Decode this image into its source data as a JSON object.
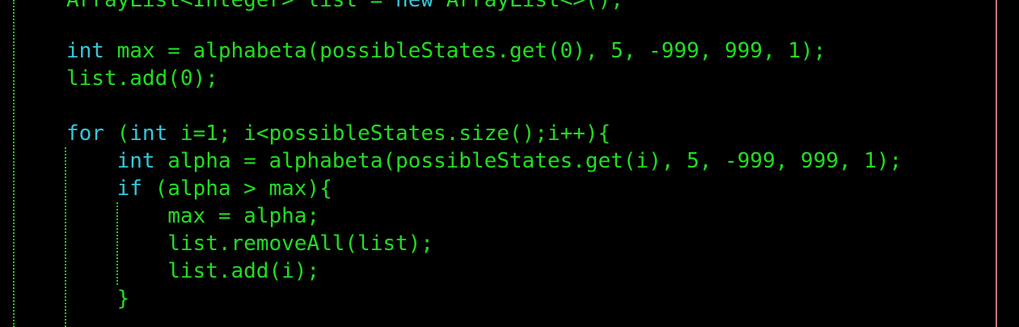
{
  "colors": {
    "background": "#000000",
    "code_text": "#22dd22",
    "keyword": "#33c8dc",
    "indent_guide": "#22c822",
    "margin_line": "#c87878"
  },
  "code": {
    "lines": [
      {
        "indent": "",
        "segments": [
          {
            "text": "ArrayList<Integer> list = ",
            "kw": false
          },
          {
            "text": "new",
            "kw": true
          },
          {
            "text": " ArrayList<>();",
            "kw": false
          }
        ]
      },
      {
        "indent": "",
        "segments": []
      },
      {
        "indent": "",
        "segments": [
          {
            "text": "int",
            "kw": true
          },
          {
            "text": " max = alphabeta(possibleStates.get(0), 5, -999, 999, 1);",
            "kw": false
          }
        ]
      },
      {
        "indent": "",
        "segments": [
          {
            "text": "list.add(0);",
            "kw": false
          }
        ]
      },
      {
        "indent": "",
        "segments": []
      },
      {
        "indent": "",
        "segments": [
          {
            "text": "for",
            "kw": true
          },
          {
            "text": " (",
            "kw": false
          },
          {
            "text": "int",
            "kw": true
          },
          {
            "text": " i=1; i<possibleStates.size();i++){",
            "kw": false
          }
        ]
      },
      {
        "indent": "    ",
        "segments": [
          {
            "text": "int",
            "kw": true
          },
          {
            "text": " alpha = alphabeta(possibleStates.get(i), 5, -999, 999, 1);",
            "kw": false
          }
        ]
      },
      {
        "indent": "    ",
        "segments": [
          {
            "text": "if",
            "kw": true
          },
          {
            "text": " (alpha > max){",
            "kw": false
          }
        ]
      },
      {
        "indent": "        ",
        "segments": [
          {
            "text": "max = alpha;",
            "kw": false
          }
        ]
      },
      {
        "indent": "        ",
        "segments": [
          {
            "text": "list.removeAll(list);",
            "kw": false
          }
        ]
      },
      {
        "indent": "        ",
        "segments": [
          {
            "text": "list.add(i);",
            "kw": false
          }
        ]
      },
      {
        "indent": "    ",
        "segments": [
          {
            "text": "}",
            "kw": false
          }
        ]
      }
    ]
  }
}
